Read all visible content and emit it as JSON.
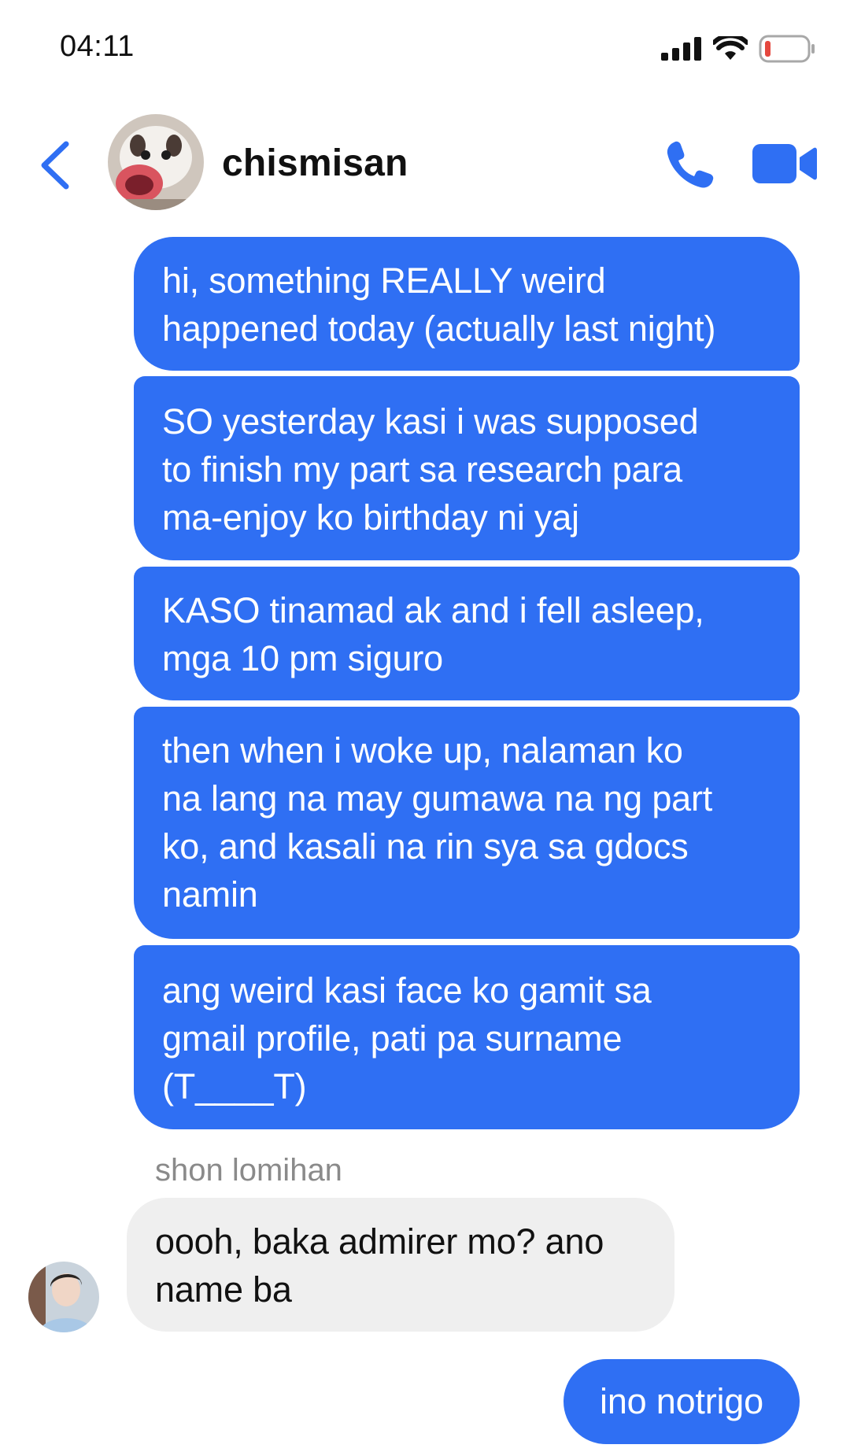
{
  "status_bar": {
    "time": "04:11",
    "icons": [
      "signal-icon",
      "wifi-icon",
      "battery-icon"
    ]
  },
  "header": {
    "chat_name": "chismisan",
    "icons": [
      "back-chevron-icon",
      "phone-icon",
      "video-camera-icon"
    ]
  },
  "colors": {
    "accent": "#2f6ff3",
    "incoming_bubble": "#efefef",
    "battery_low": "#e5483f"
  },
  "messages": [
    {
      "direction": "outgoing",
      "text": "hi, something REALLY weird\nhappened today (actually last night)"
    },
    {
      "direction": "outgoing",
      "text": "SO yesterday kasi i was supposed\nto finish my part sa research para\nma-enjoy ko birthday ni yaj"
    },
    {
      "direction": "outgoing",
      "text": "KASO tinamad ak and i fell asleep,\nmga 10 pm siguro"
    },
    {
      "direction": "outgoing",
      "text": "then when i woke up, nalaman ko\nna lang na may gumawa na ng part\nko, and kasali na rin sya sa gdocs\nnamin"
    },
    {
      "direction": "outgoing",
      "text": "ang weird kasi face ko gamit sa\ngmail profile, pati pa surname\n(T____T)"
    },
    {
      "direction": "incoming",
      "sender": "shon lomihan",
      "text": "oooh, baka admirer mo? ano\nname ba"
    },
    {
      "direction": "outgoing",
      "text": "ino notrigo"
    }
  ]
}
